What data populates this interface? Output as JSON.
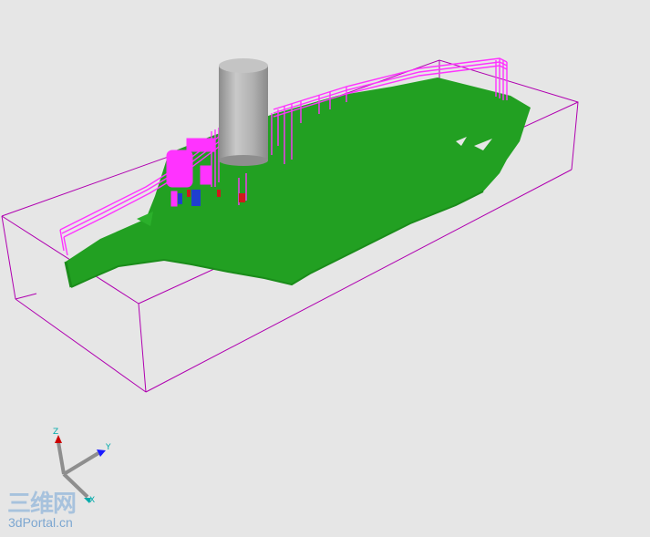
{
  "viewport": {
    "background": "#e6e6e6",
    "bounding_box_color": "#b000b0",
    "hull_color": "#22a022",
    "pipe_color": "#ff33ff",
    "tank_color": "#a9a9a9"
  },
  "axis_triad": {
    "z_label": "Z",
    "y_label": "Y",
    "x_label": "X",
    "z_color": "#cc0000",
    "y_color": "#1a1aff",
    "x_color": "#00aaaa"
  },
  "watermark": {
    "chinese": "三维网",
    "site": "3dPortal.cn"
  }
}
